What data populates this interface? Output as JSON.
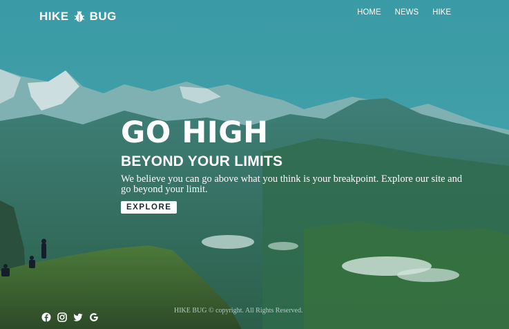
{
  "brand": {
    "name_left": "HIKE",
    "name_right": "BUG",
    "icon": "bug-icon"
  },
  "nav": {
    "items": [
      {
        "label": "HOME"
      },
      {
        "label": "NEWS"
      },
      {
        "label": "HIKE"
      }
    ]
  },
  "hero": {
    "title": "GO HIGH",
    "subtitle": "BEYOND YOUR LIMITS",
    "description": "We believe you can go above what you think is your breakpoint. Explore our site and go beyond your limit.",
    "cta_label": "EXPLORE"
  },
  "footer": {
    "copyright": "HIKE BUG © copyright. All Rights Reserved.",
    "social_icons": [
      "facebook-icon",
      "instagram-icon",
      "twitter-icon",
      "google-icon"
    ]
  },
  "colors": {
    "sky": "#3d9ba6",
    "mountain": "#2f6b5a",
    "snow": "#d9e6e8",
    "grass": "#4f6e2e",
    "button_bg": "#ffffff",
    "button_text": "#1d2a30"
  }
}
